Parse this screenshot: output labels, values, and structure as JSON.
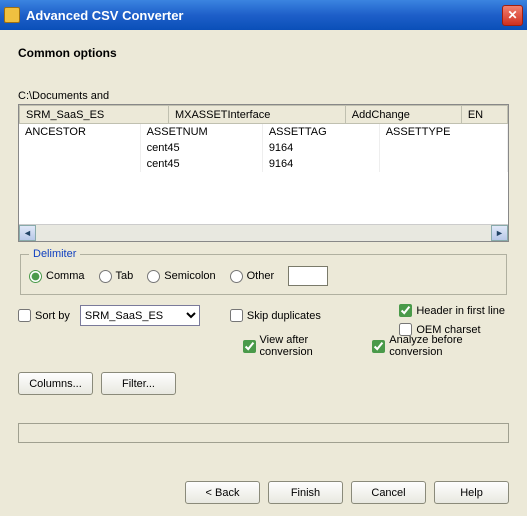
{
  "window": {
    "title": "Advanced CSV Converter"
  },
  "section_title": "Common options",
  "path": "C:\\Documents and",
  "grid": {
    "headers": [
      "SRM_SaaS_ES",
      "MXASSETInterface",
      "AddChange",
      "EN"
    ],
    "rows": [
      [
        "ANCESTOR",
        "ASSETNUM",
        "ASSETTAG",
        "ASSETTYPE"
      ],
      [
        "",
        "cent45",
        "9164",
        ""
      ],
      [
        "",
        "cent45",
        "9164",
        ""
      ]
    ]
  },
  "delimiter": {
    "legend": "Delimiter",
    "comma": "Comma",
    "tab": "Tab",
    "semicolon": "Semicolon",
    "other": "Other"
  },
  "checks": {
    "header_first": "Header in first line",
    "oem": "OEM charset",
    "sort_by": "Sort by",
    "skip_dup": "Skip duplicates",
    "view_after": "View after conversion",
    "analyze": "Analyze before conversion"
  },
  "sort_field": "SRM_SaaS_ES",
  "buttons": {
    "columns": "Columns...",
    "filter": "Filter...",
    "back": "< Back",
    "finish": "Finish",
    "cancel": "Cancel",
    "help": "Help"
  }
}
